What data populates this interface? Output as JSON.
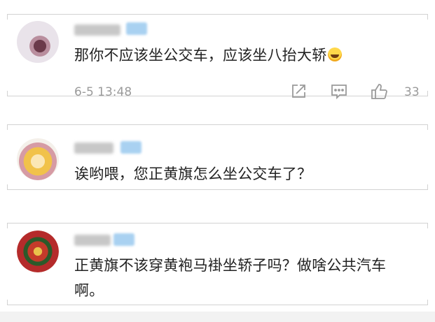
{
  "comments": [
    {
      "text": "那你不应该坐公交车，应该坐八抬大轿",
      "emoji": "laughing-tears-emoji",
      "time": "6-5 13:48",
      "likes": "33"
    },
    {
      "text": "诶哟喂，您正黄旗怎么坐公交车了？"
    },
    {
      "text": "正黄旗不该穿黄袍马褂坐轿子吗？做啥公共汽车啊。"
    }
  ],
  "icons": {
    "share": "share-icon",
    "comment": "comment-icon",
    "like": "thumbs-up-icon"
  }
}
